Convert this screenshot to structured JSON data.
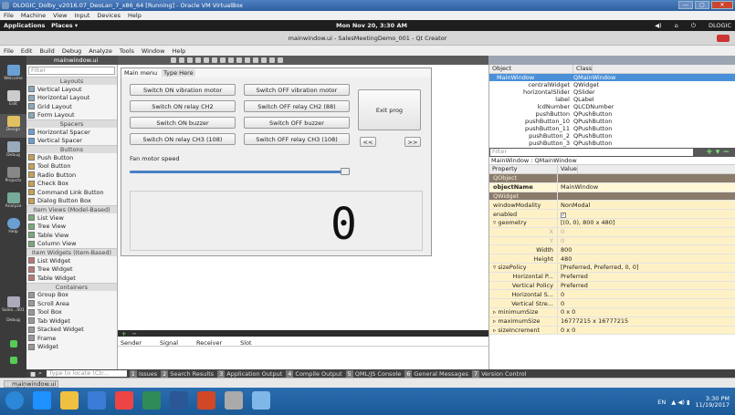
{
  "vbox": {
    "title": "DLOGIC_Dolby_v2016.07_DeoLan_7_x86_64 [Running] - Oracle VM VirtualBox",
    "min": "—",
    "max": "▢",
    "close": "✕",
    "menu": [
      "File",
      "Machine",
      "View",
      "Input",
      "Devices",
      "Help"
    ]
  },
  "gnome": {
    "apps": "Applications",
    "places": "Places",
    "clock": "Mon Nov 20,  3:30 AM",
    "user": "DLOGIC"
  },
  "qtc": {
    "title": "mainwindow.ui - SalesMeetingDemo_001 - Qt Creator",
    "menu": [
      "File",
      "Edit",
      "Build",
      "Debug",
      "Analyze",
      "Tools",
      "Window",
      "Help"
    ],
    "file_tab": "mainwindow.ui"
  },
  "modes": [
    "Welcome",
    "Edit",
    "Design",
    "Debug",
    "Projects",
    "Analyze",
    "Help"
  ],
  "bottom_modes": [
    "Sales...001",
    "Debug"
  ],
  "widgetbox": {
    "filter_placeholder": "Filter",
    "groups": [
      {
        "cat": "Layouts",
        "items": [
          "Vertical Layout",
          "Horizontal Layout",
          "Grid Layout",
          "Form Layout"
        ]
      },
      {
        "cat": "Spacers",
        "items": [
          "Horizontal Spacer",
          "Vertical Spacer"
        ]
      },
      {
        "cat": "Buttons",
        "items": [
          "Push Button",
          "Tool Button",
          "Radio Button",
          "Check Box",
          "Command Link Button",
          "Dialog Button Box"
        ]
      },
      {
        "cat": "Item Views (Model-Based)",
        "items": [
          "List View",
          "Tree View",
          "Table View",
          "Column View"
        ]
      },
      {
        "cat": "Item Widgets (Item-Based)",
        "items": [
          "List Widget",
          "Tree Widget",
          "Table Widget"
        ]
      },
      {
        "cat": "Containers",
        "items": [
          "Group Box",
          "Scroll Area",
          "Tool Box",
          "Tab Widget",
          "Stacked Widget",
          "Frame",
          "Widget"
        ]
      }
    ]
  },
  "form": {
    "menu": [
      "Main menu",
      "Type Here"
    ],
    "buttons": {
      "vib_on": "Switch ON vibration motor",
      "vib_off": "Switch OFF vibration motor",
      "relay2_on": "Switch ON relay CH2",
      "relay2_off": "Switch OFF relay CH2 (88)",
      "buzz_on": "Switch ON buzzer",
      "buzz_off": "Switch OFF buzzer",
      "relay3_on": "Switch ON relay CH3 (108)",
      "relay3_off": "Switch OFF relay CH3 (108)",
      "exit": "Exit prog",
      "prev": "<<",
      "next": ">>"
    },
    "fan_label": "Fan motor speed",
    "lcd_value": "0",
    "slider_position": 1.0
  },
  "signals": {
    "cols": [
      "Sender",
      "Signal",
      "Receiver",
      "Slot"
    ]
  },
  "inspector": {
    "cols": [
      "Object",
      "Class"
    ],
    "rows": [
      {
        "n": "MainWindow",
        "c": "QMainWindow",
        "sel": true
      },
      {
        "n": "centralWidget",
        "c": "QWidget"
      },
      {
        "n": "horizontalSlider",
        "c": "QSlider"
      },
      {
        "n": "label",
        "c": "QLabel"
      },
      {
        "n": "lcdNumber",
        "c": "QLCDNumber"
      },
      {
        "n": "pushButton",
        "c": "QPushButton"
      },
      {
        "n": "pushButton_10",
        "c": "QPushButton"
      },
      {
        "n": "pushButton_11",
        "c": "QPushButton"
      },
      {
        "n": "pushButton_2",
        "c": "QPushButton"
      },
      {
        "n": "pushButton_3",
        "c": "QPushButton"
      }
    ]
  },
  "props": {
    "filter_placeholder": "Filter",
    "title": "MainWindow : QMainWindow",
    "cols": [
      "Property",
      "Value"
    ],
    "rows": [
      {
        "k": "QObject",
        "v": "",
        "t": "grp"
      },
      {
        "k": "objectName",
        "v": "MainWindow",
        "t": "y1",
        "bold": true
      },
      {
        "k": "QWidget",
        "v": "",
        "t": "grp"
      },
      {
        "k": "windowModality",
        "v": "NonModal",
        "t": "y2"
      },
      {
        "k": "enabled",
        "v": "",
        "t": "y2",
        "check": true
      },
      {
        "k": "▿ geometry",
        "v": "[(0, 0), 800 x 480]",
        "t": "y2"
      },
      {
        "k": "X",
        "v": "0",
        "t": "y2",
        "ind": true,
        "dim": true
      },
      {
        "k": "Y",
        "v": "0",
        "t": "y2",
        "ind": true,
        "dim": true
      },
      {
        "k": "Width",
        "v": "800",
        "t": "y2",
        "ind": true
      },
      {
        "k": "Height",
        "v": "480",
        "t": "y2",
        "ind": true
      },
      {
        "k": "▿ sizePolicy",
        "v": "[Preferred, Preferred, 0, 0]",
        "t": "y2"
      },
      {
        "k": "Horizontal P...",
        "v": "Preferred",
        "t": "y2",
        "ind": true
      },
      {
        "k": "Vertical Policy",
        "v": "Preferred",
        "t": "y2",
        "ind": true
      },
      {
        "k": "Horizontal S...",
        "v": "0",
        "t": "y2",
        "ind": true
      },
      {
        "k": "Vertical Stre...",
        "v": "0",
        "t": "y2",
        "ind": true
      },
      {
        "k": "▹ minimumSize",
        "v": "0 x 0",
        "t": "y2"
      },
      {
        "k": "▹ maximumSize",
        "v": "16777215 x 16777215",
        "t": "y2"
      },
      {
        "k": "▹ sizeIncrement",
        "v": "0 x 0",
        "t": "y2"
      }
    ]
  },
  "output": {
    "locator_placeholder": "Type to locate (Ctr...",
    "tabs": [
      {
        "num": "1",
        "label": "Issues"
      },
      {
        "num": "2",
        "label": "Search Results"
      },
      {
        "num": "3",
        "label": "Application Output"
      },
      {
        "num": "4",
        "label": "Compile Output"
      },
      {
        "num": "5",
        "label": "QML/JS Console"
      },
      {
        "num": "6",
        "label": "General Messages"
      },
      {
        "num": "7",
        "label": "Version Control"
      }
    ]
  },
  "taskbar": {
    "item": "mainwindow.ui - Sales..."
  },
  "win": {
    "lang": "EN",
    "time": "3:30 PM",
    "date": "11/19/2017"
  },
  "colors": {
    "accent": "#4a90d9",
    "grp": "#8a7b6a",
    "prop_yellow": "#fef1c6"
  }
}
